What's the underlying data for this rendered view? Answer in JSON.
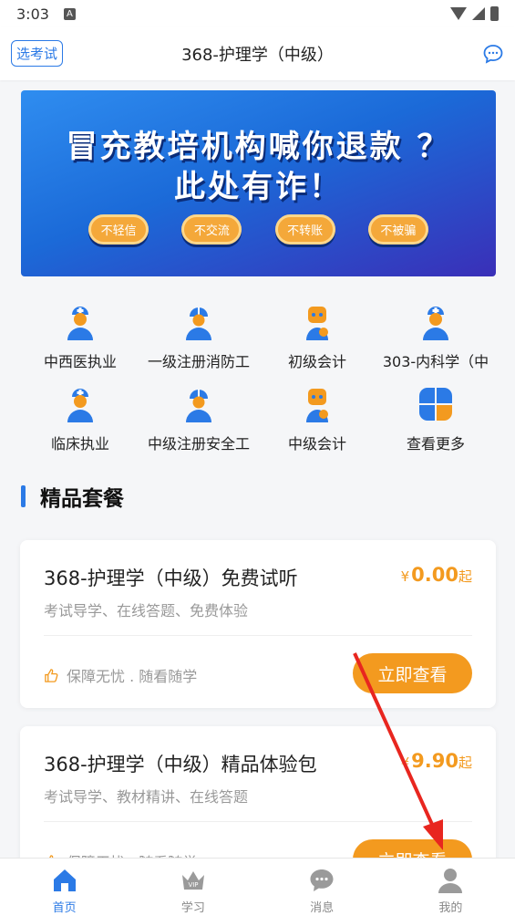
{
  "status_bar": {
    "time": "3:03",
    "notification": "A"
  },
  "header": {
    "select_exam": "选考试",
    "title": "368-护理学（中级）"
  },
  "banner": {
    "line1": "冒充教培机构喊你退款 ？",
    "line2": "此处有诈！",
    "pills": [
      "不轻信",
      "不交流",
      "不转账",
      "不被骗"
    ]
  },
  "categories": [
    {
      "label": "中西医执业",
      "icon": "doctor-icon"
    },
    {
      "label": "一级注册消防工",
      "icon": "worker-icon"
    },
    {
      "label": "初级会计",
      "icon": "accountant-icon"
    },
    {
      "label": "303-内科学（中",
      "icon": "doctor-icon"
    },
    {
      "label": "临床执业",
      "icon": "doctor-icon"
    },
    {
      "label": "中级注册安全工",
      "icon": "worker-icon"
    },
    {
      "label": "中级会计",
      "icon": "accountant-icon"
    },
    {
      "label": "查看更多",
      "icon": "more-grid-icon"
    }
  ],
  "section": {
    "title": "精品套餐"
  },
  "packages": [
    {
      "title": "368-护理学（中级）免费试听",
      "price_symbol": "¥",
      "price": "0.00",
      "price_suffix": "起",
      "desc": "考试导学、在线答题、免费体验",
      "guarantee": "保障无忧 . 随看随学",
      "button": "立即查看"
    },
    {
      "title": "368-护理学（中级）精品体验包",
      "price_symbol": "¥",
      "price": "9.90",
      "price_suffix": "起",
      "desc": "考试导学、教材精讲、在线答题",
      "guarantee": "保障无忧 . 随看随学",
      "button": "立即查看"
    }
  ],
  "tabbar": [
    {
      "label": "首页",
      "icon": "home-icon",
      "active": true
    },
    {
      "label": "学习",
      "icon": "vip-crown-icon",
      "active": false
    },
    {
      "label": "消息",
      "icon": "message-icon",
      "active": false
    },
    {
      "label": "我的",
      "icon": "profile-icon",
      "active": false
    }
  ],
  "colors": {
    "accent": "#2b7ae6",
    "orange": "#f39a1f",
    "annotation_arrow": "#e8261f"
  }
}
